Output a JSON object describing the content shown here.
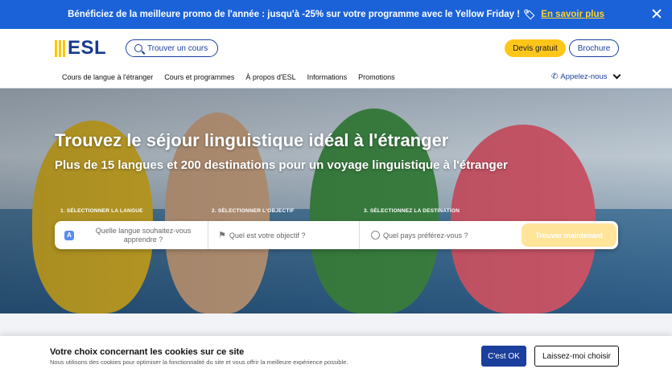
{
  "promo": {
    "text": "Bénéficiez de la meilleure promo de l'année : jusqu'à -25% sur votre programme avec le Yellow Friday !",
    "icon": "percent-tag-icon",
    "link": "En savoir plus"
  },
  "header": {
    "logo": "ESL",
    "find_course": "Trouver un cours",
    "quote": "Devis gratuit",
    "brochure": "Brochure",
    "nav": [
      "Cours de langue à l'étranger",
      "Cours et programmes",
      "À propos d'ESL",
      "Informations",
      "Promotions"
    ],
    "call": "Appelez-nous"
  },
  "hero": {
    "title": "Trouvez le séjour linguistique idéal à l'étranger",
    "subtitle": "Plus de 15 langues et 200 destinations pour un voyage linguistique à l'étranger",
    "steps": [
      "1. SÉLECTIONNER LA LANGUE",
      "2. SÉLECTIONNER L'OBJECTIF",
      "3. SÉLECTIONNEZ LA DESTINATION"
    ],
    "search": {
      "language_placeholder": "Quelle langue souhaitez-vous apprendre ?",
      "objective_placeholder": "Quel est votre objectif ?",
      "country_placeholder": "Quel pays préférez-vous ?",
      "button": "Trouver maintenant"
    }
  },
  "cookie": {
    "title": "Votre choix concernant les cookies sur ce site",
    "description": "Nous utilisons des cookies pour optimiser la fonctionnalité du site et vous offrir la meilleure expérience possible.",
    "accept": "C'est OK",
    "choose": "Laissez-moi choisir"
  },
  "colors": {
    "promo_bg": "#1b62d8",
    "brand_blue": "#1b3f9c",
    "accent_yellow": "#ffc61a"
  }
}
